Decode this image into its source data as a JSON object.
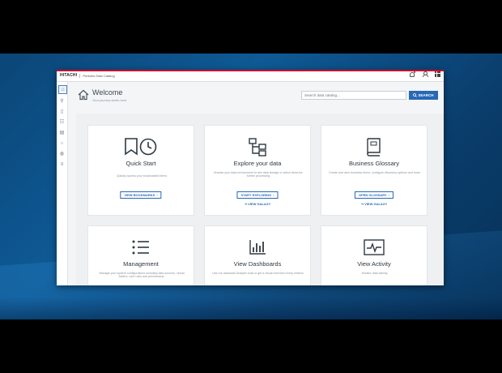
{
  "topbar": {
    "brand": "HITACHI",
    "app_title": "Pentaho Data Catalog"
  },
  "sidebar": {
    "items": [
      {
        "name": "home-icon",
        "glyph": "⌂"
      },
      {
        "name": "search-icon",
        "glyph": "⚲"
      },
      {
        "name": "bookmark-icon",
        "glyph": "▯"
      },
      {
        "name": "tree-icon",
        "glyph": "☷"
      },
      {
        "name": "glossary-icon",
        "glyph": "▤"
      },
      {
        "name": "ring-icon",
        "glyph": "∩"
      },
      {
        "name": "dashboard-icon",
        "glyph": "◍"
      },
      {
        "name": "list-icon",
        "glyph": "≡"
      }
    ]
  },
  "welcome": {
    "title": "Welcome",
    "subtitle": "Your journey starts here"
  },
  "search": {
    "placeholder": "Search data catalog...",
    "button_label": "SEARCH"
  },
  "cards": {
    "quick_start": {
      "title": "Quick Start",
      "desc": "Quickly access your bookmarked items",
      "button": "VIEW BOOKMARKS"
    },
    "explore": {
      "title": "Explore your data",
      "desc": "Browse your data environment to see data lineage or select items for further processing",
      "button": "START EXPLORING",
      "link": "VIEW GALAXY"
    },
    "glossary": {
      "title": "Business Glossary",
      "desc": "Create and view business terms, configure discovery options and more.",
      "button": "OPEN GLOSSARY",
      "link": "VIEW GALAXY"
    },
    "management": {
      "title": "Management",
      "desc": "Manage your system configurations including data sources, virtual folders, user roles and permissions."
    },
    "dashboards": {
      "title": "View Dashboards",
      "desc": "Use our advanced analytic tools to get a visual overview of key metrics."
    },
    "activity": {
      "title": "View Activity",
      "desc": "Monitor data activity."
    }
  }
}
